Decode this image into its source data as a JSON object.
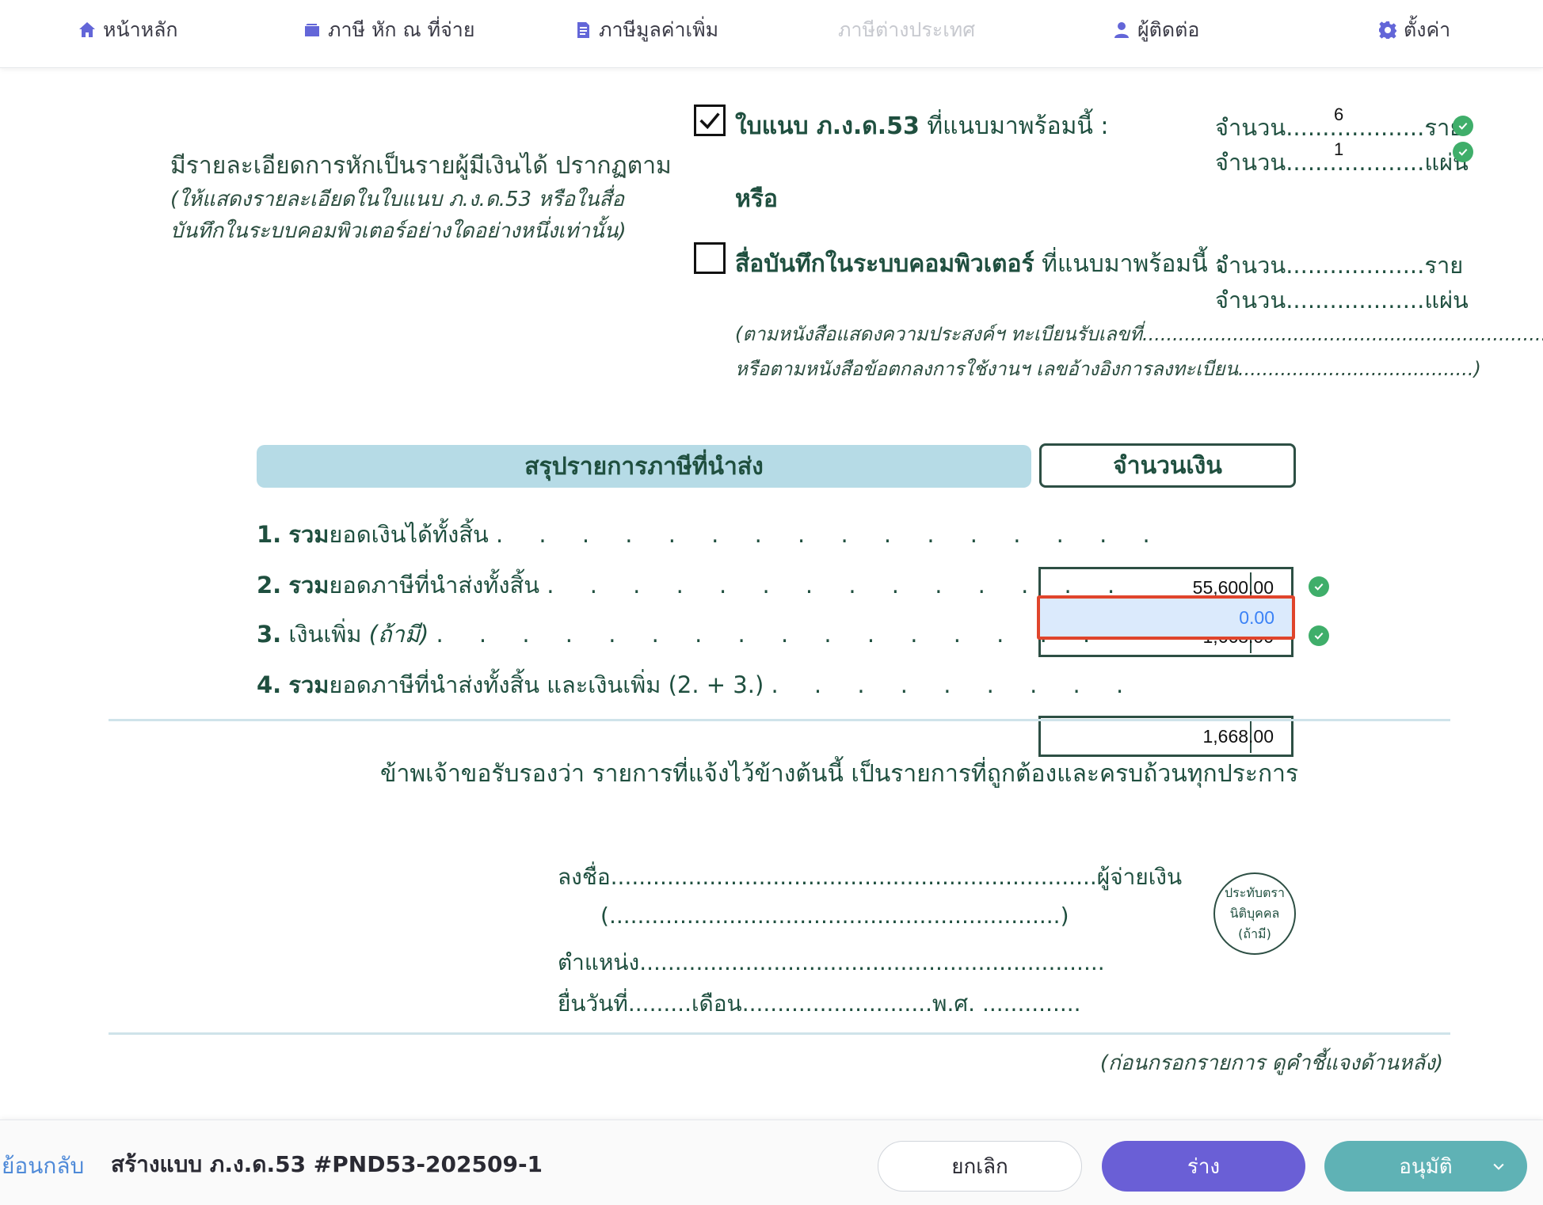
{
  "nav": {
    "items": [
      {
        "label": "หน้าหลัก",
        "icon": "home-icon"
      },
      {
        "label": "ภาษี หัก ณ ที่จ่าย",
        "icon": "wallet-icon"
      },
      {
        "label": "ภาษีมูลค่าเพิ่ม",
        "icon": "document-icon"
      },
      {
        "label": "ภาษีต่างประเทศ",
        "icon": "",
        "disabled": true
      },
      {
        "label": "ผู้ติดต่อ",
        "icon": "user-icon"
      },
      {
        "label": "ตั้งค่า",
        "icon": "gear-icon"
      }
    ],
    "accent_color": "#6366d8"
  },
  "form": {
    "intro": {
      "line1": "มีรายละเอียดการหักเป็นรายผู้มีเงินได้ ปรากฏตาม",
      "line2": "(ให้แสดงรายละเอียดในใบแนบ ภ.ง.ด.53 หรือในสื่อ",
      "line3": "บันทึกในระบบคอมพิวเตอร์อย่างใดอย่างหนึ่งเท่านั้น)"
    },
    "attachment": {
      "checked": true,
      "label_bold": "ใบแนบ ภ.ง.ด.53",
      "label_rest": " ที่แนบมาพร้อมนี้ :",
      "count_label": "จำนวน",
      "persons_value": "6",
      "persons_unit": "ราย",
      "sheets_value": "1",
      "sheets_unit": "แผ่น"
    },
    "or_label": "หรือ",
    "media": {
      "checked": false,
      "label_bold": "สื่อบันทึกในระบบคอมพิวเตอร์",
      "label_rest": " ที่แนบมาพร้อมนี้ :",
      "count_label": "จำนวน",
      "persons_unit": "ราย",
      "sheets_unit": "แผ่น",
      "note1": "(ตามหนังสือแสดงความประสงค์ฯ ทะเบียนรับเลขที่",
      "note2": "หรือตามหนังสือข้อตกลงการใช้งานฯ เลขอ้างอิงการลงทะเบียน",
      "note2_end": ")"
    },
    "summary": {
      "title": "สรุปรายการภาษีที่นำส่ง",
      "amount_header": "จำนวนเงิน",
      "rows": [
        {
          "no": "1.",
          "bold": "รวม",
          "label": "ยอดเงินได้ทั้งสิ้น",
          "amount": "55,600.00",
          "verified": true
        },
        {
          "no": "2.",
          "bold": "รวม",
          "label": "ยอดภาษีที่นำส่งทั้งสิ้น",
          "amount": "1,668.00",
          "verified": true
        },
        {
          "no": "3.",
          "bold": "",
          "label": "เงินเพิ่ม",
          "label_italic": "(ถ้ามี)",
          "amount": "0.00",
          "verified": false
        },
        {
          "no": "4.",
          "bold": "รวม",
          "label": "ยอดภาษีที่นำส่งทั้งสิ้น และเงินเพิ่ม (2. + 3.)",
          "amount": "1,668.00",
          "verified": false
        }
      ]
    },
    "certification": "ข้าพเจ้าขอรับรองว่า รายการที่แจ้งไว้ข้างต้นนี้ เป็นรายการที่ถูกต้องและครบถ้วนทุกประการ",
    "signature": {
      "sign_label": "ลงชื่อ",
      "payer_label": "ผู้จ่ายเงิน",
      "open_paren": "(",
      "close_paren": ")",
      "position_label": "ตำแหน่ง",
      "date_label": "ยื่นวันที่",
      "month_label": "เดือน",
      "year_label": "พ.ศ."
    },
    "seal": {
      "line1": "ประทับตรา",
      "line2": "นิติบุคคล",
      "line3": "(ถ้ามี)"
    },
    "footnote": "(ก่อนกรอกรายการ ดูคำชี้แจงด้านหลัง)"
  },
  "bottom_bar": {
    "back_label": "ย้อนกลับ",
    "title": "สร้างแบบ ภ.ง.ด.53 #PND53-202509-1",
    "cancel_label": "ยกเลิก",
    "draft_label": "ร่าง",
    "approve_label": "อนุมัติ",
    "draft_color": "#6a5fd6",
    "approve_color": "#5fb2b5"
  }
}
